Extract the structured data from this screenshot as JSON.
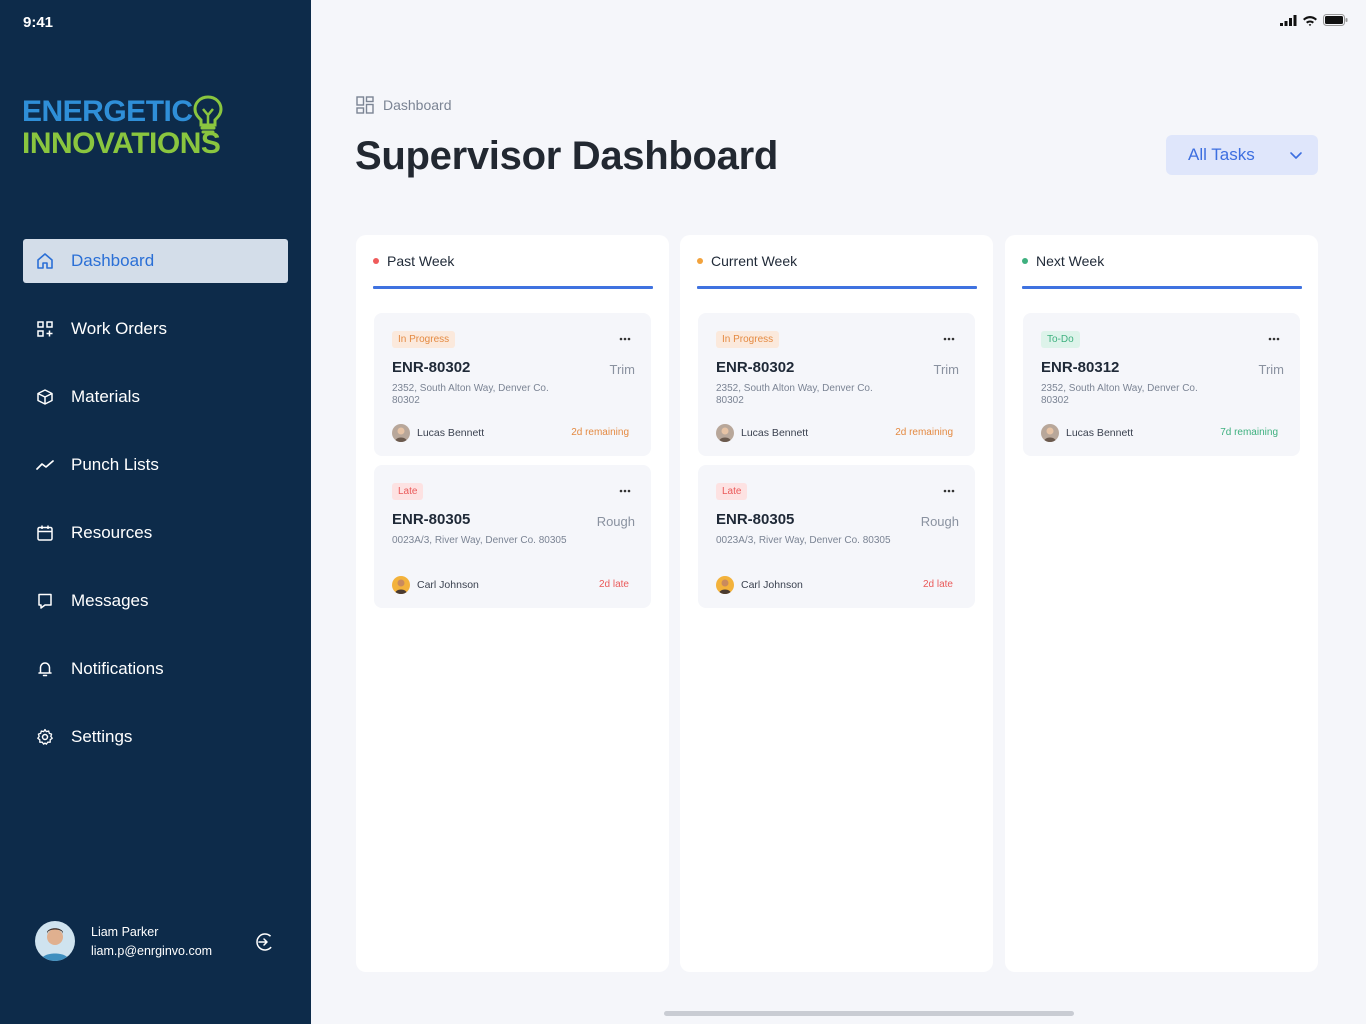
{
  "status_bar": {
    "time": "9:41"
  },
  "brand": {
    "line1": "ENERGETIC",
    "line2": "INNOVATIONS",
    "color_primary": "#2f8fd8",
    "color_secondary": "#8ac63f"
  },
  "sidebar": {
    "items": [
      {
        "label": "Dashboard",
        "icon": "home-icon",
        "active": true
      },
      {
        "label": "Work Orders",
        "icon": "grid-plus-icon"
      },
      {
        "label": "Materials",
        "icon": "cube-icon"
      },
      {
        "label": "Punch Lists",
        "icon": "trend-icon"
      },
      {
        "label": "Resources",
        "icon": "calendar-icon"
      },
      {
        "label": "Messages",
        "icon": "chat-icon"
      },
      {
        "label": "Notifications",
        "icon": "bell-icon"
      },
      {
        "label": "Settings",
        "icon": "gear-icon"
      }
    ],
    "user": {
      "name": "Liam Parker",
      "email": "liam.p@enrginvo.com"
    }
  },
  "header": {
    "breadcrumb": "Dashboard",
    "title": "Supervisor Dashboard",
    "filter": {
      "selected": "All Tasks"
    }
  },
  "columns": [
    {
      "title": "Past Week",
      "dot_color": "#ef5b5b",
      "cards": [
        {
          "status": "In Progress",
          "status_type": "progress",
          "id": "ENR-80302",
          "phase": "Trim",
          "address": "2352, South Alton Way, Denver Co. 80302",
          "assignee": "Lucas Bennett",
          "due": "2d remaining",
          "due_type": "orange"
        },
        {
          "status": "Late",
          "status_type": "late",
          "id": "ENR-80305",
          "phase": "Rough",
          "address": "0023A/3, River Way, Denver Co. 80305",
          "assignee": "Carl Johnson",
          "due": "2d late",
          "due_type": "red"
        }
      ]
    },
    {
      "title": "Current Week",
      "dot_color": "#f2a23c",
      "cards": [
        {
          "status": "In Progress",
          "status_type": "progress",
          "id": "ENR-80302",
          "phase": "Trim",
          "address": "2352, South Alton Way, Denver Co. 80302",
          "assignee": "Lucas Bennett",
          "due": "2d remaining",
          "due_type": "orange"
        },
        {
          "status": "Late",
          "status_type": "late",
          "id": "ENR-80305",
          "phase": "Rough",
          "address": "0023A/3, River Way, Denver Co. 80305",
          "assignee": "Carl Johnson",
          "due": "2d late",
          "due_type": "red"
        }
      ]
    },
    {
      "title": "Next Week",
      "dot_color": "#3eb07f",
      "cards": [
        {
          "status": "To-Do",
          "status_type": "todo",
          "id": "ENR-80312",
          "phase": "Trim",
          "address": "2352, South Alton Way, Denver Co. 80302",
          "assignee": "Lucas Bennett",
          "due": "7d remaining",
          "due_type": "green"
        }
      ]
    }
  ]
}
